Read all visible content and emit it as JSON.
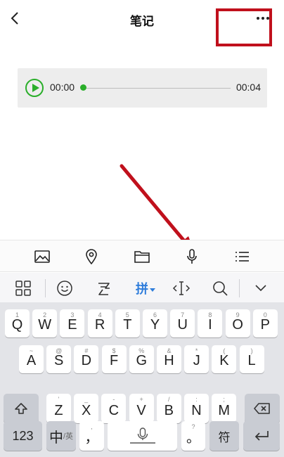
{
  "header": {
    "title": "笔记"
  },
  "audio": {
    "current_time": "00:00",
    "total_time": "00:04",
    "progress": 0
  },
  "annotation": {
    "box_color": "#c0101c",
    "arrow_color": "#c0101c"
  },
  "toolbar": {
    "items": [
      {
        "name": "image-icon"
      },
      {
        "name": "location-pin-icon"
      },
      {
        "name": "folder-icon"
      },
      {
        "name": "microphone-icon"
      },
      {
        "name": "list-icon"
      }
    ]
  },
  "keyboard": {
    "candidate_bar": {
      "pinyin_label": "拼",
      "items": [
        "grid-menu-icon",
        "emoji-icon",
        "handwriting-icon",
        "pinyin-mode",
        "cursor-move-icon",
        "search-icon",
        "collapse-icon"
      ]
    },
    "rows": [
      {
        "keys": [
          {
            "main": "Q",
            "hint": "1"
          },
          {
            "main": "W",
            "hint": "2"
          },
          {
            "main": "E",
            "hint": "3"
          },
          {
            "main": "R",
            "hint": "4"
          },
          {
            "main": "T",
            "hint": "5"
          },
          {
            "main": "Y",
            "hint": "6"
          },
          {
            "main": "U",
            "hint": "7"
          },
          {
            "main": "I",
            "hint": "8"
          },
          {
            "main": "O",
            "hint": "9"
          },
          {
            "main": "P",
            "hint": "0"
          }
        ]
      },
      {
        "keys": [
          {
            "main": "A",
            "hint": "~"
          },
          {
            "main": "S",
            "hint": "@"
          },
          {
            "main": "D",
            "hint": "#"
          },
          {
            "main": "F",
            "hint": "$"
          },
          {
            "main": "G",
            "hint": "%"
          },
          {
            "main": "H",
            "hint": "&"
          },
          {
            "main": "J",
            "hint": "*"
          },
          {
            "main": "K",
            "hint": "("
          },
          {
            "main": "L",
            "hint": ")"
          }
        ]
      },
      {
        "keys": [
          {
            "main": "Z",
            "hint": "'"
          },
          {
            "main": "X",
            "hint": "_"
          },
          {
            "main": "C",
            "hint": "-"
          },
          {
            "main": "V",
            "hint": "+"
          },
          {
            "main": "B",
            "hint": "/"
          },
          {
            "main": "N",
            "hint": ":"
          },
          {
            "main": "M",
            "hint": ";"
          }
        ]
      }
    ],
    "bottom": {
      "num_label": "123",
      "zh_label": "中",
      "en_label": "/英",
      "comma_label": "，",
      "comma_hint": ",",
      "period_label": "。",
      "period_hint": "?",
      "symbol_label": "符"
    }
  }
}
